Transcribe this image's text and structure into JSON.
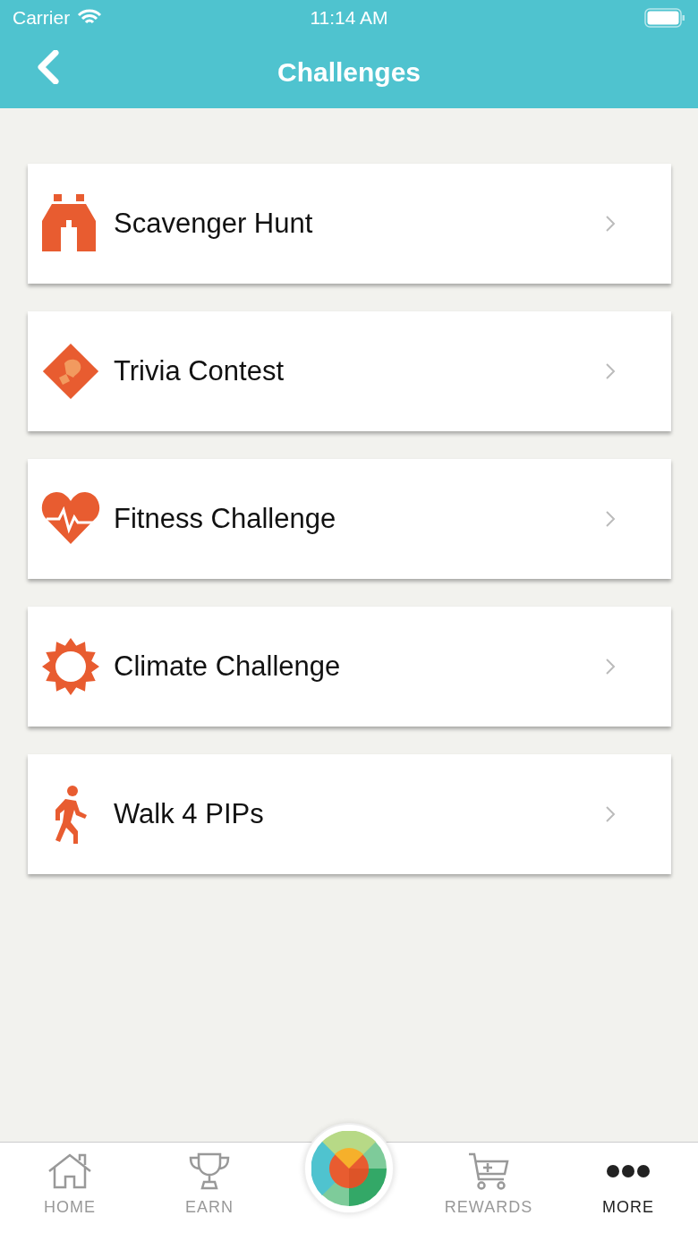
{
  "status_bar": {
    "carrier": "Carrier",
    "time": "11:14 AM"
  },
  "nav": {
    "title": "Challenges"
  },
  "challenges": [
    {
      "label": "Scavenger Hunt",
      "kind": "binoculars"
    },
    {
      "label": "Trivia Contest",
      "kind": "trivia"
    },
    {
      "label": "Fitness Challenge",
      "kind": "heart"
    },
    {
      "label": "Climate Challenge",
      "kind": "sun"
    },
    {
      "label": "Walk 4 PIPs",
      "kind": "walker"
    }
  ],
  "tab_bar": [
    {
      "label": "HOME",
      "kind": "home",
      "selected": false
    },
    {
      "label": "EARN",
      "kind": "trophy",
      "selected": false
    },
    {
      "kind": "logo",
      "selected": false
    },
    {
      "label": "REWARDS",
      "kind": "cart",
      "selected": false
    },
    {
      "label": "MORE",
      "kind": "dots",
      "selected": true
    }
  ]
}
